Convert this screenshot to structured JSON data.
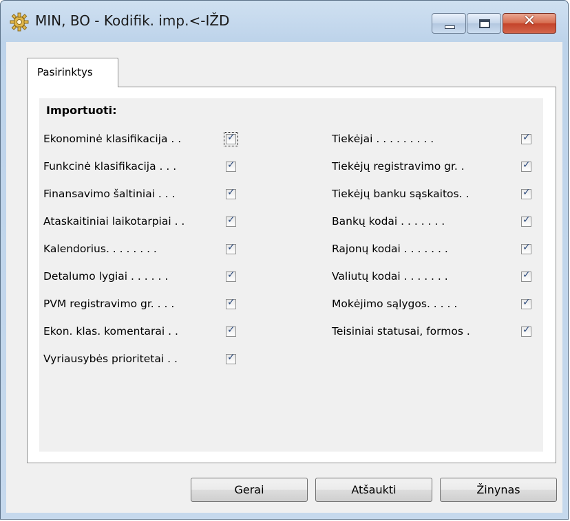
{
  "window": {
    "title": "MIN, BO - Kodifik. imp.<-IŽD",
    "controls": {
      "close": "✕"
    }
  },
  "tab": {
    "label": "Pasirinktys"
  },
  "group": {
    "title": "Importuoti:"
  },
  "left_items": [
    {
      "label": "Ekonominė klasifikacija . .",
      "checked": true
    },
    {
      "label": "Funkcinė klasifikacija . . .",
      "checked": true
    },
    {
      "label": "Finansavimo šaltiniai . . .",
      "checked": true
    },
    {
      "label": "Ataskaitiniai laikotarpiai . .",
      "checked": true
    },
    {
      "label": "Kalendorius. . . . . . . .",
      "checked": true
    },
    {
      "label": "Detalumo lygiai . . . . . .",
      "checked": true
    },
    {
      "label": "PVM registravimo gr. . . .",
      "checked": true
    },
    {
      "label": "Ekon. klas. komentarai . .",
      "checked": true
    },
    {
      "label": "Vyriausybės prioritetai . .",
      "checked": true
    }
  ],
  "right_items": [
    {
      "label": "Tiekėjai . . . . . . . . .",
      "checked": true
    },
    {
      "label": "Tiekėjų registravimo gr. .",
      "checked": true
    },
    {
      "label": "Tiekėjų banku sąskaitos. .",
      "checked": true
    },
    {
      "label": "Bankų kodai . . . . . . .",
      "checked": true
    },
    {
      "label": "Rajonų kodai . . . . . . .",
      "checked": true
    },
    {
      "label": "Valiutų kodai . . . . . . .",
      "checked": true
    },
    {
      "label": "Mokėjimo sąlygos. . . . .",
      "checked": true
    },
    {
      "label": "Teisiniai statusai, formos .",
      "checked": true
    }
  ],
  "buttons": {
    "ok": "Gerai",
    "cancel": "Atšaukti",
    "help": "Žinynas"
  }
}
